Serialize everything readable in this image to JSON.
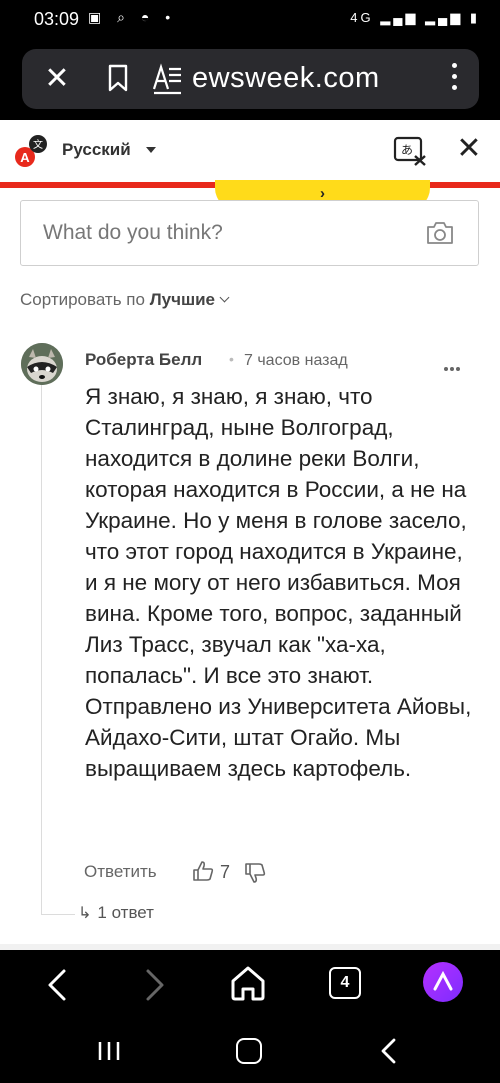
{
  "status_bar": {
    "time": "03:09",
    "network": "4G",
    "battery": "▮"
  },
  "browser": {
    "url_text": "ewsweek.com"
  },
  "translate_bar": {
    "language": "Русский"
  },
  "banner": {
    "arrow": "›"
  },
  "comment_box": {
    "placeholder": "What do you think?"
  },
  "sort": {
    "label": "Сортировать по",
    "value": "Лучшие"
  },
  "comment": {
    "author": "Роберта Белл",
    "separator": "•",
    "time": "7 часов назад",
    "text": "Я знаю, я знаю, я знаю, что Сталинград, ныне Волгоград, находится в долине реки Волги, которая находится в России, а не на Украине. Но у меня в голове засело, что этот город находится в Украине, и я не могу от него избавиться. Моя вина. Кроме того, вопрос, заданный Лиз Трасс, звучал как \"ха-ха, попалась\". И все это знают. Отправлено из Университета Айовы, Айдахо-Сити, штат Огайо. Мы выращиваем здесь картофель.",
    "reply_label": "Ответить",
    "likes": "7",
    "replies_label": "1 ответ"
  },
  "toolbar": {
    "tab_count": "4"
  },
  "colors": {
    "accent_red": "#e8291c",
    "banner_yellow": "#ffdb1a",
    "alice_purple": "#9b2dff"
  }
}
